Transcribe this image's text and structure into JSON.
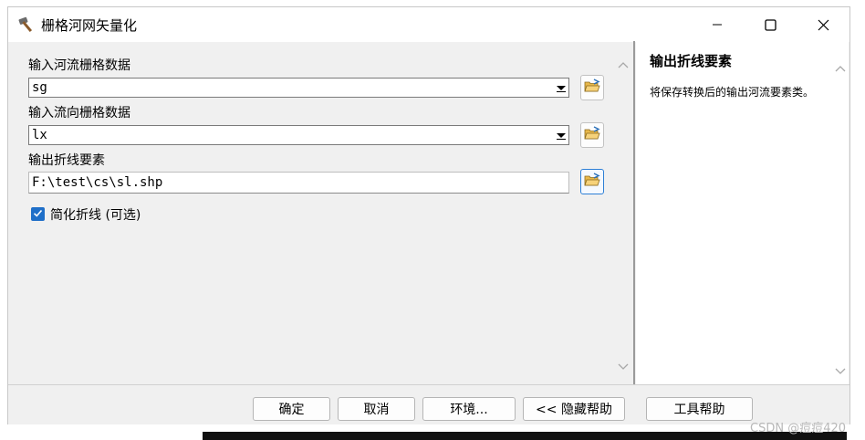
{
  "window": {
    "title": "栅格河网矢量化",
    "app_icon": "hammer-icon",
    "controls": [
      "minimize-icon",
      "maximize-icon",
      "close-icon"
    ]
  },
  "form": {
    "river_raster": {
      "label": "输入河流栅格数据",
      "value": "sg"
    },
    "flow_direction": {
      "label": "输入流向栅格数据",
      "value": "lx"
    },
    "output_features": {
      "label": "输出折线要素",
      "value": "F:\\test\\cs\\sl.shp"
    },
    "simplify": {
      "label": "简化折线 (可选)",
      "checked": true
    }
  },
  "help": {
    "title": "输出折线要素",
    "text": "将保存转换后的输出河流要素类。"
  },
  "buttons": {
    "ok": "确定",
    "cancel": "取消",
    "environments": "环境...",
    "hide_help": "<< 隐藏帮助",
    "tool_help": "工具帮助"
  },
  "watermark": "CSDN @痘痘420",
  "colors": {
    "accent": "#1f6fc8",
    "window_bg": "#f0f0f0"
  }
}
